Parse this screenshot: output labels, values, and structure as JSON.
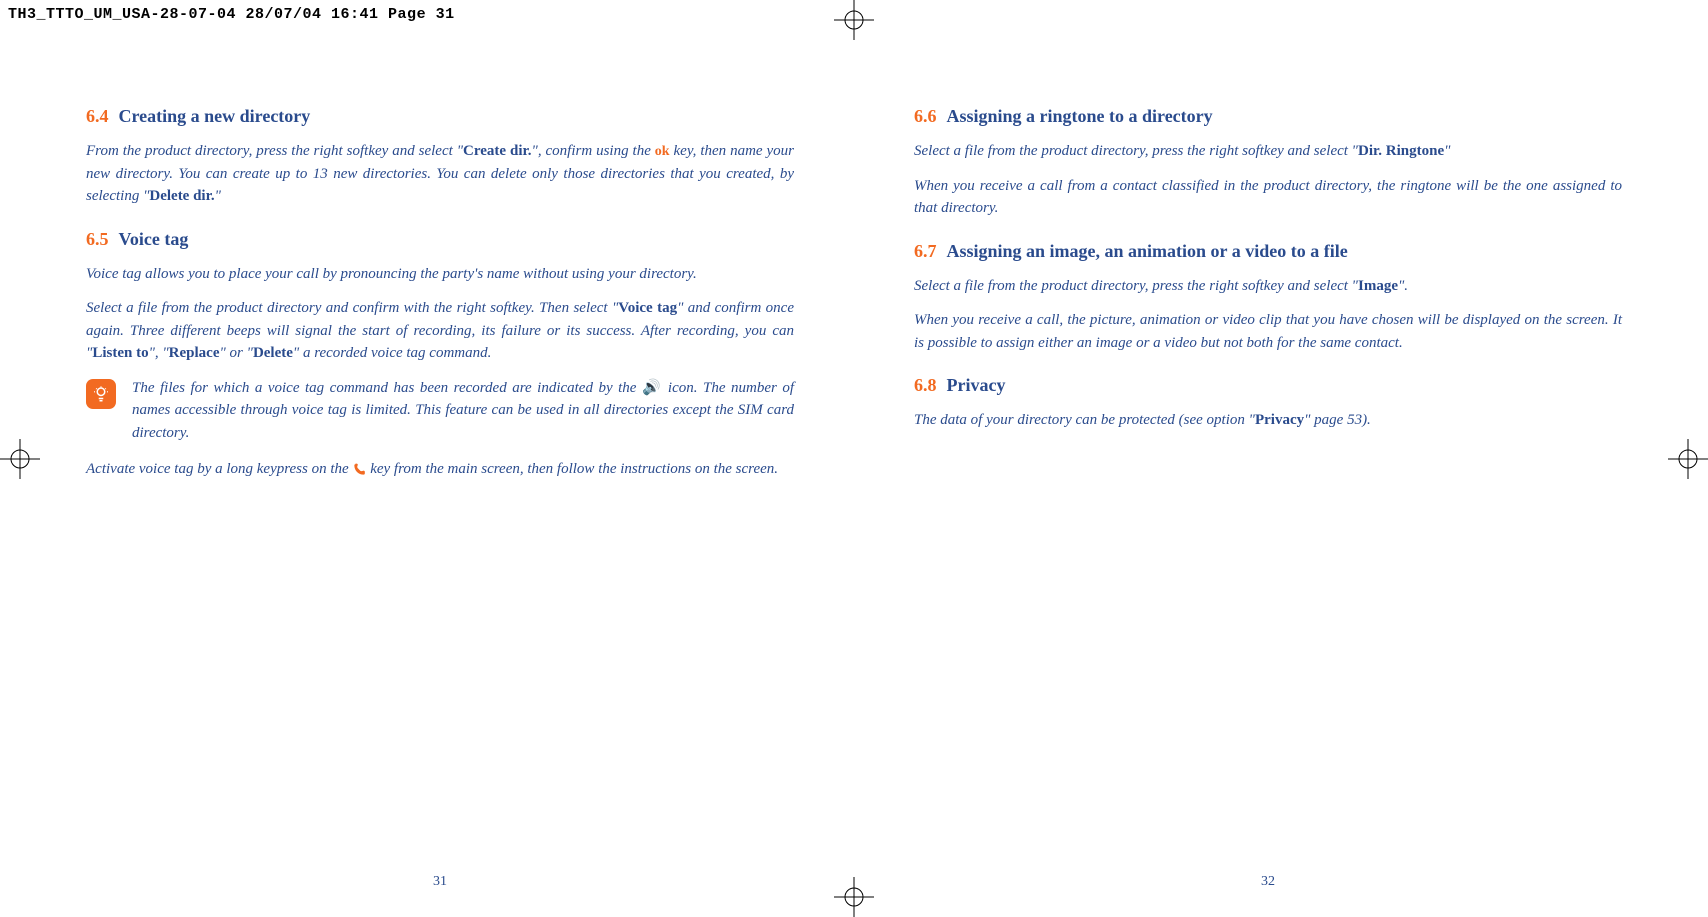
{
  "header": "TH3_TTTO_UM_USA-28-07-04  28/07/04  16:41  Page 31",
  "left": {
    "s64": {
      "num": "6.4",
      "title": "Creating a new directory",
      "p1a": "From the product directory, press the right softkey and select \"",
      "p1b": "Create dir.",
      "p1c": "\", confirm using the ",
      "p1ok": "ok",
      "p1d": " key, then name your new directory. You can create up to 13 new directories. You can delete only those directories that you created, by selecting \"",
      "p1e": "Delete dir.",
      "p1f": "\""
    },
    "s65": {
      "num": "6.5",
      "title": "Voice tag",
      "p1": "Voice tag allows you to place your call by pronouncing the party's name without using your directory.",
      "p2a": "Select a file from the product directory and confirm with the right softkey. Then select \"",
      "p2b": "Voice tag",
      "p2c": "\" and confirm once again. Three different beeps will signal the start of recording, its failure or its success. After recording, you can \"",
      "p2d": "Listen to",
      "p2e": "\", \"",
      "p2f": "Replace",
      "p2g": "\" or \"",
      "p2h": "Delete",
      "p2i": "\" a recorded voice tag command.",
      "tipa": "The files for which a voice tag command has been recorded are indicated by the ",
      "tipicon": "🔊",
      "tipb": " icon. The number of names accessible through voice tag is limited. This feature can be used in all directories except the SIM card directory.",
      "p3a": "Activate voice tag by a long keypress on the ",
      "p3key": "⌕",
      "p3b": " key from the main screen, then follow the instructions on the screen."
    },
    "pagenum": "31"
  },
  "right": {
    "s66": {
      "num": "6.6",
      "title": "Assigning a ringtone to a directory",
      "p1a": "Select a file from the product directory, press the right softkey and select \"",
      "p1b": "Dir. Ringtone",
      "p1c": "\"",
      "p2": "When you receive a call from a contact classified in the product directory, the ringtone will be the one assigned to that directory."
    },
    "s67": {
      "num": "6.7",
      "title": "Assigning an image, an animation or a video to a file",
      "p1a": "Select a file from the product directory, press the right softkey and select \"",
      "p1b": "Image",
      "p1c": "\".",
      "p2": "When you receive a call, the picture, animation or video clip that you have chosen will be displayed on the screen. It is possible to assign either an image or a video but not both for the same contact."
    },
    "s68": {
      "num": "6.8",
      "title": "Privacy",
      "p1a": "The data of your directory can be protected (see option \"",
      "p1b": "Privacy",
      "p1c": "\" page 53)."
    },
    "pagenum": "32"
  }
}
